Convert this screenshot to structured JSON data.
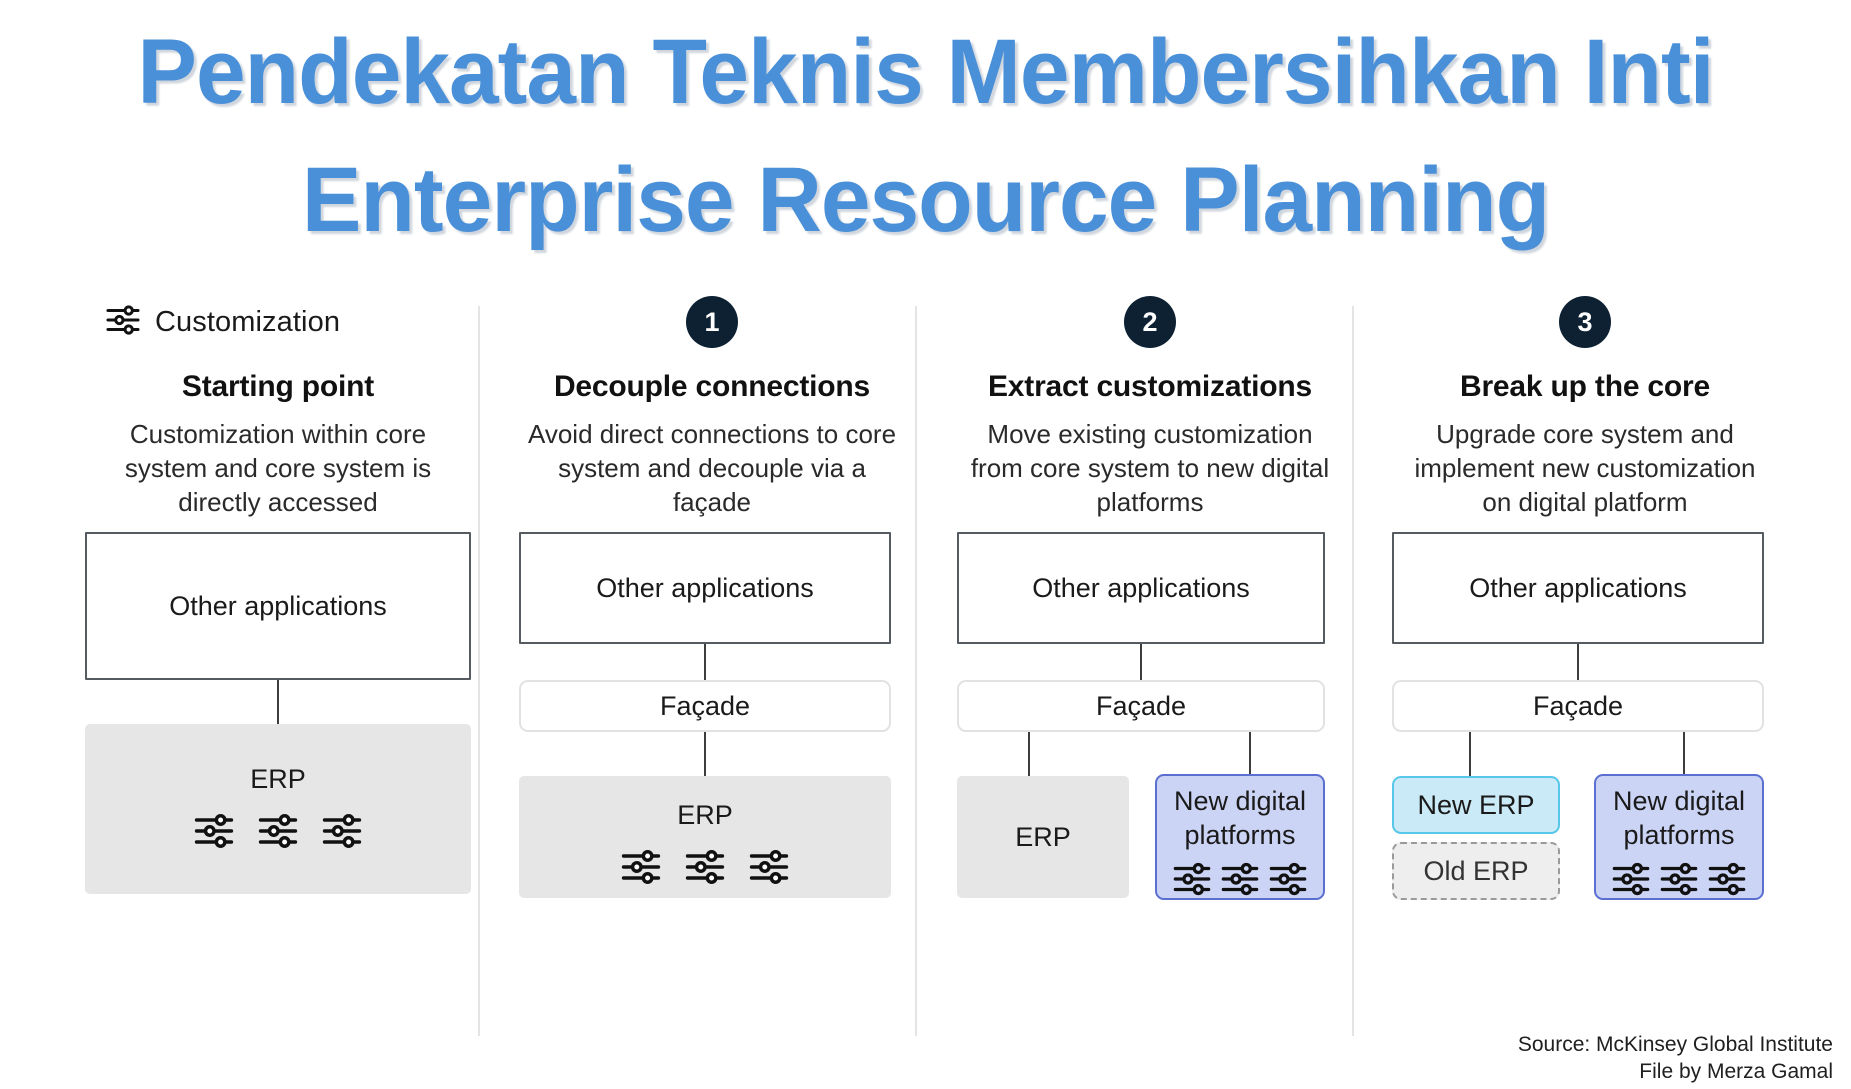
{
  "title": {
    "line1": "Pendekatan Teknis Membersihkan Inti",
    "line2": "Enterprise Resource Planning",
    "color": "#4a90d9"
  },
  "legend": {
    "icon": "sliders-icon",
    "label": "Customization"
  },
  "colors": {
    "badge_bg": "#0d2133",
    "apps_border": "#555b60",
    "erp_fill": "#e6e6e6",
    "new_digital_fill": "#ccd4f5",
    "new_digital_border": "#5b6fd0",
    "new_erp_fill": "#cbeaf7",
    "new_erp_border": "#56c7e8",
    "old_erp_border": "#9a9a9a",
    "divider": "#e4e4e4",
    "connector": "#3d3d3d"
  },
  "columns": [
    {
      "badge": "",
      "title": "Starting point",
      "desc": "Customization within core system and core system is directly accessed",
      "boxes": {
        "apps": "Other applications",
        "facade": null,
        "erp": "ERP",
        "new_digital": null,
        "new_erp": null,
        "old_erp": null
      },
      "erp_icons": 3
    },
    {
      "badge": "1",
      "title": "Decouple connections",
      "desc": "Avoid direct connections to core system and decouple via a façade",
      "boxes": {
        "apps": "Other applications",
        "facade": "Façade",
        "erp": "ERP",
        "new_digital": null,
        "new_erp": null,
        "old_erp": null
      },
      "erp_icons": 3
    },
    {
      "badge": "2",
      "title": "Extract customizations",
      "desc": "Move existing customization from core system to new digital platforms",
      "boxes": {
        "apps": "Other applications",
        "facade": "Façade",
        "erp": "ERP",
        "new_digital": "New digital platforms",
        "new_erp": null,
        "old_erp": null
      },
      "new_digital_icons": 3
    },
    {
      "badge": "3",
      "title": "Break up the core",
      "desc": "Upgrade core system and implement new customization on digital platform",
      "boxes": {
        "apps": "Other applications",
        "facade": "Façade",
        "erp": null,
        "new_digital": "New digital platforms",
        "new_erp": "New ERP",
        "old_erp": "Old ERP"
      },
      "new_digital_icons": 3
    }
  ],
  "source": {
    "line1": "Source: McKinsey Global Institute",
    "line2": "File by Merza Gamal"
  }
}
